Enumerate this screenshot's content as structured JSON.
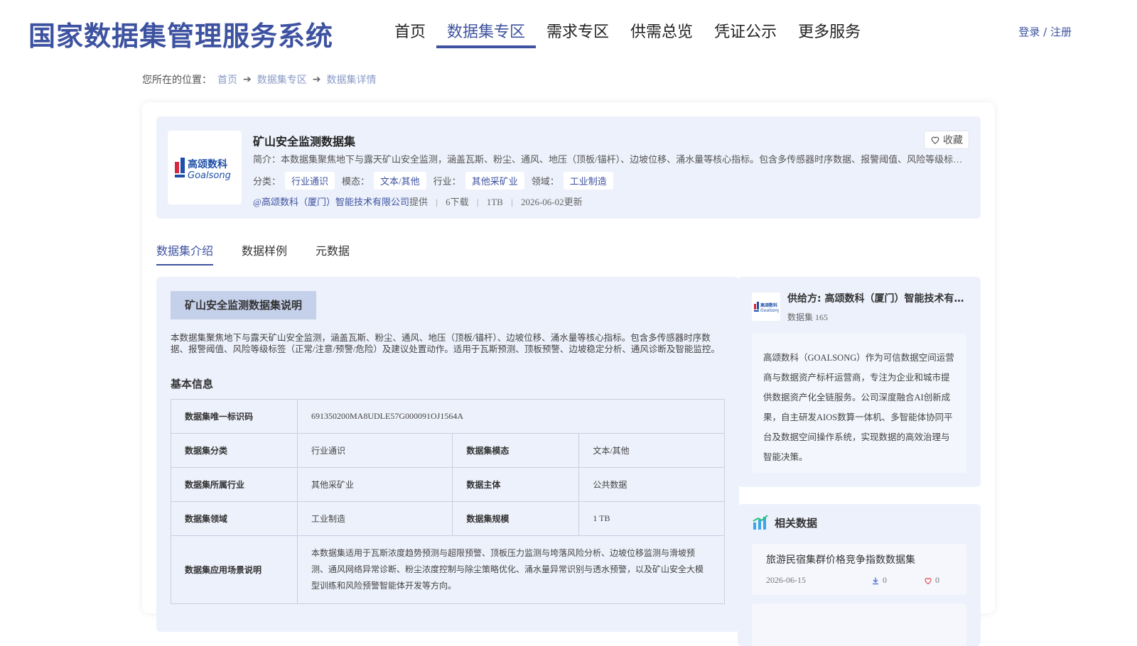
{
  "header": {
    "site_title": "国家数据集管理服务系统",
    "nav": [
      "首页",
      "数据集专区",
      "需求专区",
      "供需总览",
      "凭证公示",
      "更多服务"
    ],
    "login": "登录 / 注册"
  },
  "breadcrumb": {
    "prefix": "您所在的位置：",
    "items": [
      "首页",
      "数据集专区",
      "数据集详情"
    ]
  },
  "dataset": {
    "title": "矿山安全监测数据集",
    "intro": "简介：本数据集聚焦地下与露天矿山安全监测，涵盖瓦斯、粉尘、通风、地压（顶板/锚杆）、边坡位移、涌水量等核心指标。包含多传感器时序数据、报警阈值、风险等级标签（正常/注意/预警/危险）及建议处置动作。",
    "fav_label": "收藏",
    "tags": [
      {
        "label": "分类：",
        "value": "行业通识"
      },
      {
        "label": "模态：",
        "value": "文本/其他"
      },
      {
        "label": "行业：",
        "value": "其他采矿业"
      },
      {
        "label": "领域：",
        "value": "工业制造"
      }
    ],
    "provider": "@高颂数科（厦门）智能技术有限公司",
    "provider_suffix": "提供",
    "downloads": "6下载",
    "size": "1TB",
    "updated": "2026-06-02更新",
    "logo_cn": "高颂数科",
    "logo_en": "Goalsong"
  },
  "tabs": [
    "数据集介绍",
    "数据样例",
    "元数据"
  ],
  "intro_section": {
    "title": "矿山安全监测数据集说明",
    "desc": "本数据集聚焦地下与露天矿山安全监测，涵盖瓦斯、粉尘、通风、地压（顶板/锚杆）、边坡位移、涌水量等核心指标。包含多传感器时序数据、报警阈值、风险等级标签（正常/注意/预警/危险）及建议处置动作。适用于瓦斯预测、顶板预警、边坡稳定分析、通风诊断及智能监控。",
    "basic_title": "基本信息",
    "id_key": "数据集唯一标识码",
    "id_val": "691350200MA8UDLE57G000091OJ1564A",
    "rows": [
      {
        "k1": "数据集分类",
        "v1": "行业通识",
        "k2": "数据集模态",
        "v2": "文本/其他"
      },
      {
        "k1": "数据集所属行业",
        "v1": "其他采矿业",
        "k2": "数据主体",
        "v2": "公共数据"
      },
      {
        "k1": "数据集领域",
        "v1": "工业制造",
        "k2": "数据集规模",
        "v2": "1 TB"
      }
    ],
    "scene_key": "数据集应用场景说明",
    "scene_val": "本数据集适用于瓦斯浓度趋势预测与超限预警、顶板压力监测与垮落风险分析、边坡位移监测与滑坡预测、通风网络异常诊断、粉尘浓度控制与除尘策略优化、涌水量异常识别与透水预警，以及矿山安全大模型训练和风险预警智能体开发等方向。"
  },
  "provider_card": {
    "name": "供给方: 高颂数科（厦门）智能技术有限公司",
    "count": "数据集 165",
    "desc": "高颂数科（GOALSONG）作为可信数据空间运营商与数据资产标杆运营商，专注为企业和城市提供数据资产化全链服务。公司深度融合AI创新成果，自主研发AIOS数算一体机、多智能体协同平台及数据空间操作系统，实现数据的高效治理与智能决策。"
  },
  "related": {
    "title": "相关数据",
    "items": [
      {
        "name": "旅游民宿集群价格竞争指数数据集",
        "date": "2026-06-15",
        "downloads": "0",
        "likes": "0"
      }
    ]
  },
  "colors": {
    "brand": "#3d52a0",
    "panel": "#edf1fb",
    "logo_red": "#d7263d",
    "logo_blue": "#1e4fa8"
  }
}
